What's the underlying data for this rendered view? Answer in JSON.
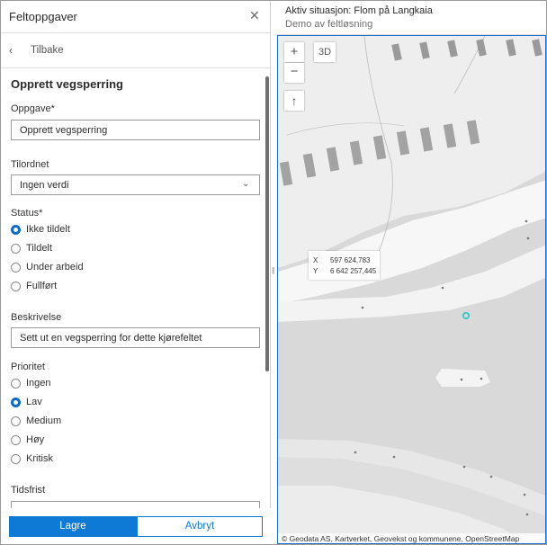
{
  "panel": {
    "title": "Feltoppgaver",
    "close_icon": "close-icon",
    "back_label": "Tilbake"
  },
  "form": {
    "section_title": "Opprett vegsperring",
    "task_label": "Oppgave*",
    "task_value": "Opprett vegsperring",
    "assigned_label": "Tilordnet",
    "assigned_value": "Ingen verdi",
    "status_label": "Status*",
    "status_options": [
      "Ikke tildelt",
      "Tildelt",
      "Under arbeid",
      "Fullført"
    ],
    "status_selected": 0,
    "description_label": "Beskrivelse",
    "description_value": "Sett ut en vegsperring for dette kjørefeltet",
    "priority_label": "Prioritet",
    "priority_options": [
      "Ingen",
      "Lav",
      "Medium",
      "Høy",
      "Kritisk"
    ],
    "priority_selected": 2,
    "deadline_label": "Tidsfrist"
  },
  "footer": {
    "save_label": "Lagre",
    "cancel_label": "Avbryt"
  },
  "map": {
    "title": "Aktiv situasjon: Flom på Langkaia",
    "subtitle": "Demo av feltløsning",
    "zoom_in": "+",
    "zoom_out": "−",
    "view_3d": "3D",
    "compass": "↑",
    "coord_x_label": "X",
    "coord_x_value": "597 624,783",
    "coord_y_label": "Y",
    "coord_y_value": "6 642 257,445",
    "attribution": "© Geodata AS, Kartverket, Geovekst og kommunene, OpenStreetMap",
    "accent_color": "#0f79d6",
    "marker_color": "#22c7c7"
  }
}
